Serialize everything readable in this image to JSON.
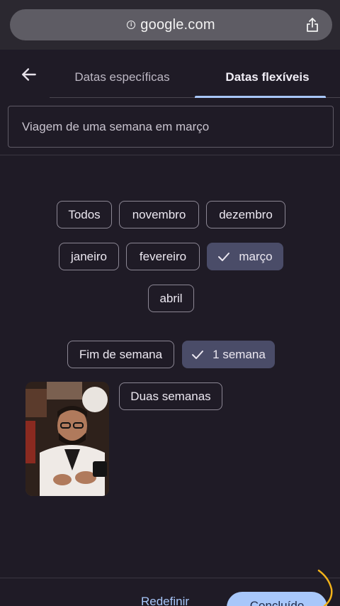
{
  "browser": {
    "url": "google.com"
  },
  "tabs": [
    {
      "label": "Datas específicas",
      "active": false
    },
    {
      "label": "Datas flexíveis",
      "active": true
    }
  ],
  "search": {
    "value": "Viagem de uma semana em março"
  },
  "months": [
    {
      "label": "Todos",
      "selected": false
    },
    {
      "label": "novembro",
      "selected": false
    },
    {
      "label": "dezembro",
      "selected": false
    },
    {
      "label": "janeiro",
      "selected": false
    },
    {
      "label": "fevereiro",
      "selected": false
    },
    {
      "label": "março",
      "selected": true
    },
    {
      "label": "abril",
      "selected": false
    }
  ],
  "durations": [
    {
      "label": "Fim de semana",
      "selected": false
    },
    {
      "label": "1 semana",
      "selected": true
    },
    {
      "label": "Duas semanas",
      "selected": false
    }
  ],
  "footer": {
    "reset_label": "Redefinir",
    "done_label": "Concluído"
  },
  "colors": {
    "background": "#1f1b26",
    "selected_chip": "#4a4c68",
    "accent": "#a8c7fa"
  }
}
